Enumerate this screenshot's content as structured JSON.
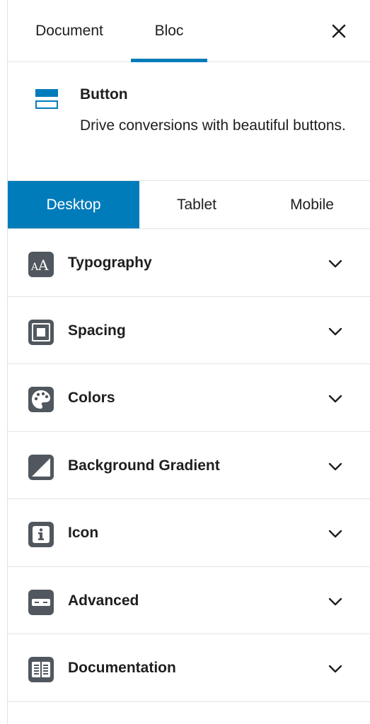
{
  "header": {
    "tabs": [
      {
        "label": "Document"
      },
      {
        "label": "Bloc"
      }
    ]
  },
  "block": {
    "title": "Button",
    "description": "Drive conversions with beautiful buttons.",
    "icon": "button-block-icon"
  },
  "devices": [
    {
      "label": "Desktop",
      "active": true
    },
    {
      "label": "Tablet",
      "active": false
    },
    {
      "label": "Mobile",
      "active": false
    }
  ],
  "panels": [
    {
      "label": "Typography",
      "icon": "typography-icon"
    },
    {
      "label": "Spacing",
      "icon": "spacing-icon"
    },
    {
      "label": "Colors",
      "icon": "palette-icon"
    },
    {
      "label": "Background Gradient",
      "icon": "gradient-icon"
    },
    {
      "label": "Icon",
      "icon": "info-icon"
    },
    {
      "label": "Advanced",
      "icon": "advanced-icon"
    },
    {
      "label": "Documentation",
      "icon": "documentation-icon"
    }
  ],
  "colors": {
    "accent": "#007cba",
    "icon_gray": "#50575e",
    "border": "#e2e4e7"
  }
}
